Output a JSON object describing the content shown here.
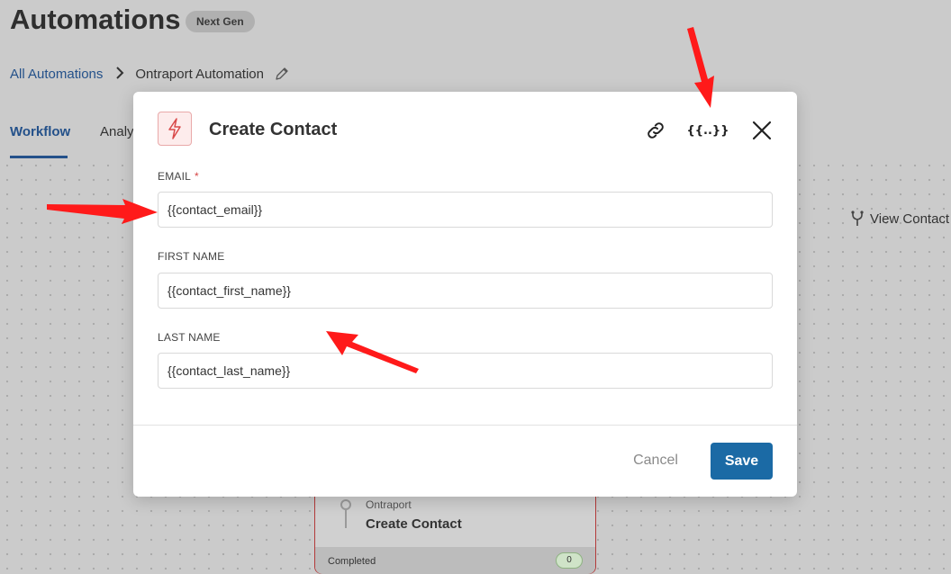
{
  "header": {
    "title": "Automations",
    "badge": "Next Gen"
  },
  "breadcrumb": {
    "root": "All Automations",
    "current": "Ontraport Automation"
  },
  "tabs": {
    "workflow": "Workflow",
    "analytics": "Analy"
  },
  "canvas": {
    "view_contact": "View Contact",
    "node": {
      "app": "Ontraport",
      "title": "Create Contact",
      "status": "Completed",
      "count": "0"
    }
  },
  "modal": {
    "title": "Create Contact",
    "vars_label": "{{..}}",
    "fields": {
      "email": {
        "label": "EMAIL",
        "required_mark": "*",
        "value": "{{contact_email}}"
      },
      "first_name": {
        "label": "FIRST NAME",
        "value": "{{contact_first_name}}"
      },
      "last_name": {
        "label": "LAST NAME",
        "value": "{{contact_last_name}}"
      }
    },
    "cancel_label": "Cancel",
    "save_label": "Save"
  },
  "colors": {
    "accent": "#1b6aa5",
    "link": "#24518a",
    "annotation_arrow": "#ff1a1a"
  }
}
